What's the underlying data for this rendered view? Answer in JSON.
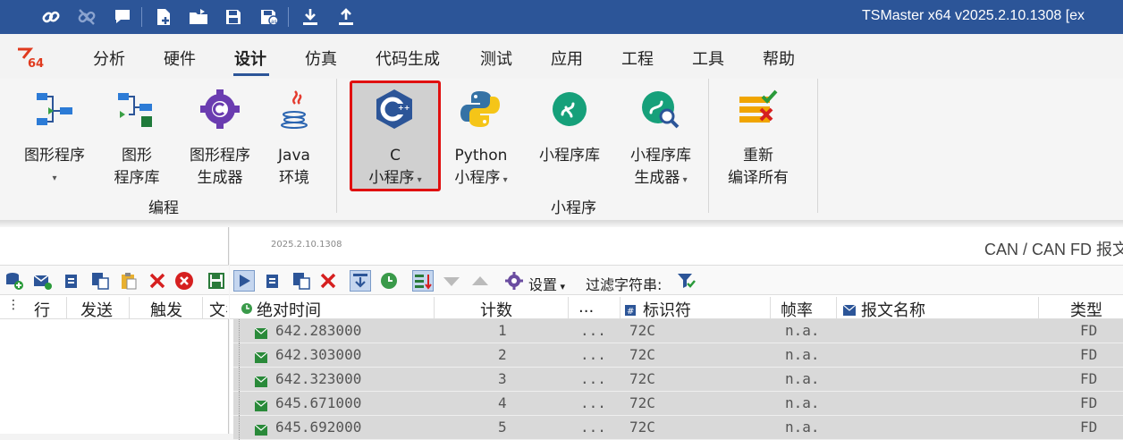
{
  "title_bar": {
    "app_title": "TSMaster x64 v2025.2.10.1308 [ex",
    "bg_color": "#2c5598",
    "quick_access": [
      "link-icon",
      "unlink-icon",
      "comment-icon",
      "new-file-icon",
      "open-folder-icon",
      "save-icon",
      "save-as-icon",
      "download-icon",
      "upload-icon"
    ]
  },
  "menu": {
    "tabs": [
      "分析",
      "硬件",
      "设计",
      "仿真",
      "代码生成",
      "测试",
      "应用",
      "工程",
      "工具",
      "帮助"
    ],
    "active": "设计"
  },
  "ribbon": {
    "groups": {
      "programming": {
        "label": "编程",
        "buttons": [
          {
            "line1": "图形程序",
            "line2": "▾"
          },
          {
            "line1": "图形",
            "line2": "程序库"
          },
          {
            "line1": "图形程序",
            "line2": "生成器"
          },
          {
            "line1": "Java",
            "line2": "环境"
          }
        ]
      },
      "mini_program": {
        "label": "小程序",
        "buttons": [
          {
            "line1": "C",
            "line2": "小程序"
          },
          {
            "line1": "Python",
            "line2": "小程序"
          },
          {
            "line1": "小程序库",
            "line2": ""
          },
          {
            "line1": "小程序库",
            "line2": "生成器"
          },
          {
            "line1": "重新",
            "line2": "编译所有"
          }
        ]
      }
    }
  },
  "left_panel": {
    "columns": [
      "行",
      "发送",
      "触发",
      "文名"
    ]
  },
  "right_panel": {
    "version": "2025.2.10.1308",
    "title": "CAN / CAN FD 报文",
    "toolbar": {
      "settings_label": "设置",
      "filter_label": "过滤字符串:"
    },
    "columns": [
      "绝对时间",
      "计数",
      "...",
      "标识符",
      "帧率",
      "报文名称",
      "类型"
    ],
    "rows": [
      {
        "time": "642.283000",
        "count": "1",
        "more": "...",
        "id": "72C",
        "rate": "n.a.",
        "name": "",
        "type": "FD"
      },
      {
        "time": "642.303000",
        "count": "2",
        "more": "...",
        "id": "72C",
        "rate": "n.a.",
        "name": "",
        "type": "FD"
      },
      {
        "time": "642.323000",
        "count": "3",
        "more": "...",
        "id": "72C",
        "rate": "n.a.",
        "name": "",
        "type": "FD"
      },
      {
        "time": "645.671000",
        "count": "4",
        "more": "...",
        "id": "72C",
        "rate": "n.a.",
        "name": "",
        "type": "FD"
      },
      {
        "time": "645.692000",
        "count": "5",
        "more": "...",
        "id": "72C",
        "rate": "n.a.",
        "name": "",
        "type": "FD"
      }
    ]
  }
}
